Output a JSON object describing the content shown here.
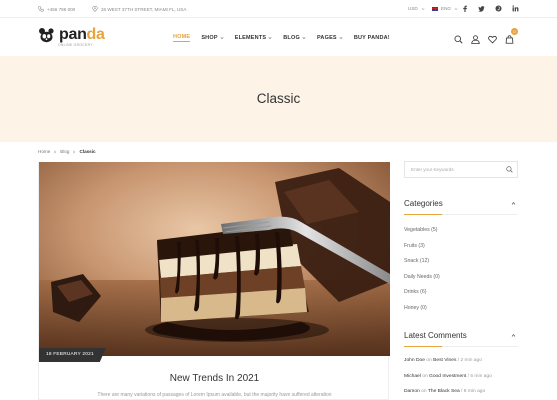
{
  "topbar": {
    "phone": "+456 786 000",
    "address": "26 WEST 37TH STREET, MIAMI FL, USA",
    "currency": "USD",
    "language": "ENG",
    "socials": [
      "facebook-icon",
      "twitter-icon",
      "pinterest-icon",
      "linkedin-icon"
    ]
  },
  "logo": {
    "name_main": "pan",
    "name_accent": "da",
    "tagline": "ONLINE GROCERY"
  },
  "nav": [
    {
      "label": "HOME",
      "active": true,
      "dropdown": false
    },
    {
      "label": "SHOP",
      "active": false,
      "dropdown": true
    },
    {
      "label": "ELEMENTS",
      "active": false,
      "dropdown": true
    },
    {
      "label": "BLOG",
      "active": false,
      "dropdown": true
    },
    {
      "label": "PAGES",
      "active": false,
      "dropdown": true
    },
    {
      "label": "BUY PANDA!",
      "active": false,
      "dropdown": false
    }
  ],
  "header_icons": {
    "cart_count": "0"
  },
  "page_title": "Classic",
  "breadcrumb": {
    "home": "Home",
    "blog": "Blog",
    "current": "Classic"
  },
  "post": {
    "date": "18 FEBRUARY 2021",
    "title": "New Trends In 2021",
    "excerpt": "There are many variations of passages of Lorem Ipsum available, but the majority have suffered alteration"
  },
  "search": {
    "placeholder": "Enter your Keywords"
  },
  "categories": {
    "title": "Categories",
    "items": [
      {
        "label": "Vegetables (5)"
      },
      {
        "label": "Fruits (3)"
      },
      {
        "label": "Snack (12)"
      },
      {
        "label": "Daily Needs (0)"
      },
      {
        "label": "Drinks (6)"
      },
      {
        "label": "Honey (0)"
      }
    ]
  },
  "latest_comments": {
    "title": "Latest Comments",
    "on": "on",
    "items": [
      {
        "author": "John Doe",
        "post": "Best Vines",
        "time": "/ 2 min ago"
      },
      {
        "author": "Michael",
        "post": "Good Investment",
        "time": "/ 5 min ago"
      },
      {
        "author": "Damon",
        "post": "The Black Sea",
        "time": "/ 8 min ago"
      }
    ]
  },
  "colors": {
    "accent": "#e8a33d",
    "band": "#fdf3e7",
    "dark": "#333333"
  }
}
